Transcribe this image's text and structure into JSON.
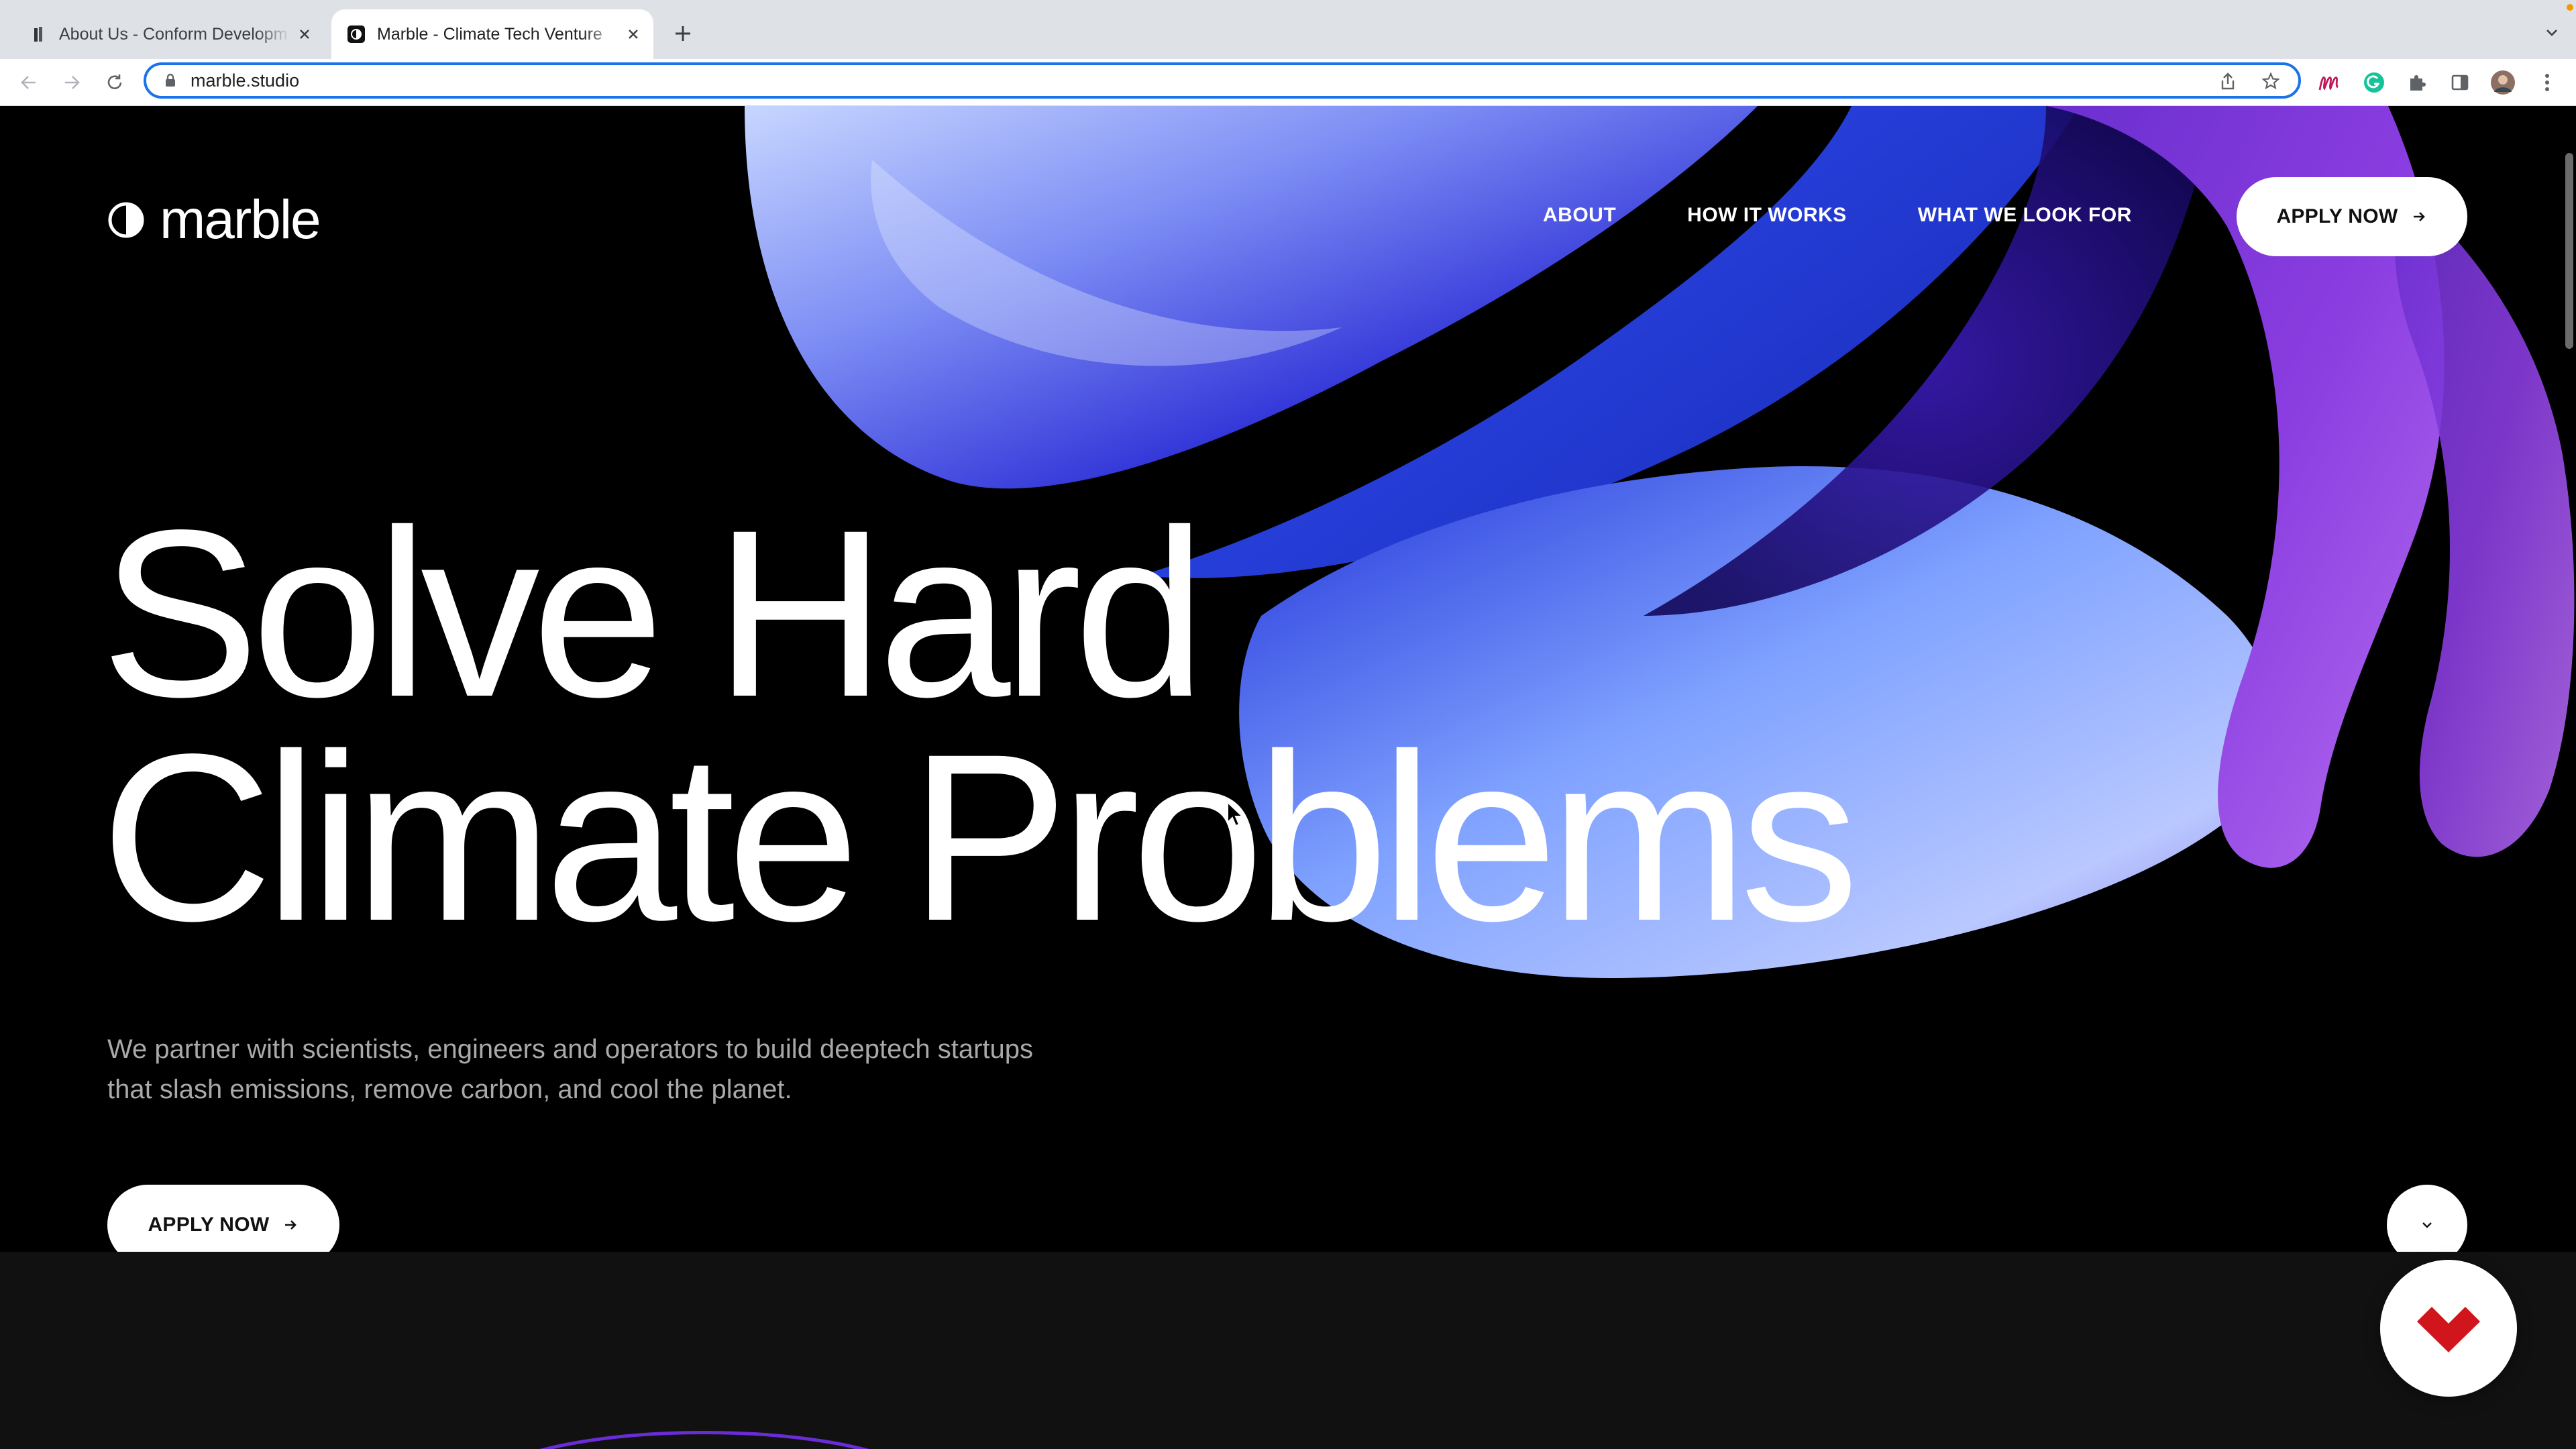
{
  "browser": {
    "tabs": [
      {
        "title": "About Us - Conform Developm",
        "active": false
      },
      {
        "title": "Marble - Climate Tech Venture",
        "active": true
      }
    ],
    "url": "marble.studio"
  },
  "site": {
    "logo_text": "marble",
    "nav": [
      {
        "label": "ABOUT"
      },
      {
        "label": "HOW IT WORKS"
      },
      {
        "label": "WHAT WE LOOK FOR"
      }
    ],
    "apply_top_label": "APPLY NOW",
    "headline_line1": "Solve Hard",
    "headline_line2": "Climate Problems",
    "subtext": "We partner with scientists, engineers and operators to build deeptech startups that slash emissions, remove carbon, and cool the planet.",
    "apply_hero_label": "APPLY NOW"
  },
  "colors": {
    "background": "#000000",
    "text": "#ffffff",
    "subtext": "#a9a9a9",
    "accent_blue": "#2f3be8",
    "accent_purple": "#7a35d6",
    "widget_red": "#d0161c",
    "omnibox_focus": "#1a73e8"
  },
  "icons": {
    "logo_mark": "half-circle-icon",
    "scroll": "chevron-down-icon",
    "widget": "heart-like-logo-icon"
  }
}
